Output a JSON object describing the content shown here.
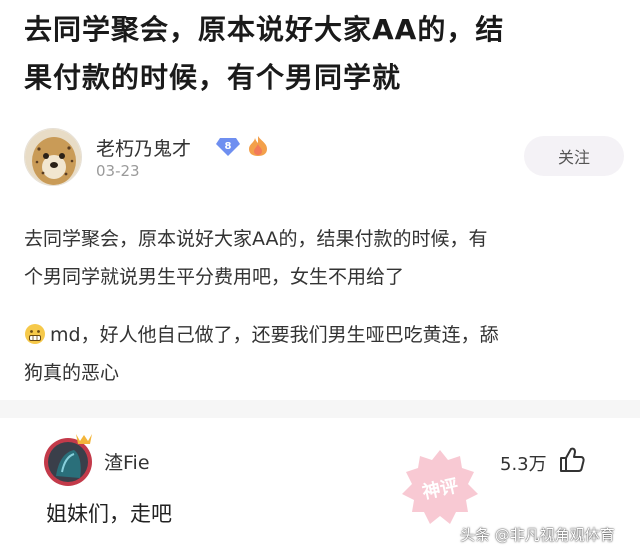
{
  "post": {
    "title_line1": "去同学聚会，原本说好大家AA的，结",
    "title_line2": "果付款的时候，有个男同学就",
    "author_name": "老朽乃鬼才",
    "vip_level": "8",
    "date": "03-23",
    "follow_label": "关注",
    "body_line1": "去同学聚会，原本说好大家AA的，结果付款的时候，有",
    "body_line2": "个男同学就说男生平分费用吧，女生不用给了",
    "para2_line1": "md，好人他自己做了，还要我们男生哑巴吃黄连，舔",
    "para2_line2": "狗真的恶心"
  },
  "comment": {
    "username": "渣Fie",
    "like_count": "5.3万",
    "text": "姐妹们，走吧",
    "stamp_label": "神评"
  },
  "watermark": "头条 @非凡视角观体育",
  "colors": {
    "vip_badge": "#6f8ff0",
    "stamp": "#f08aa0",
    "separator": "#f6f6f6"
  }
}
